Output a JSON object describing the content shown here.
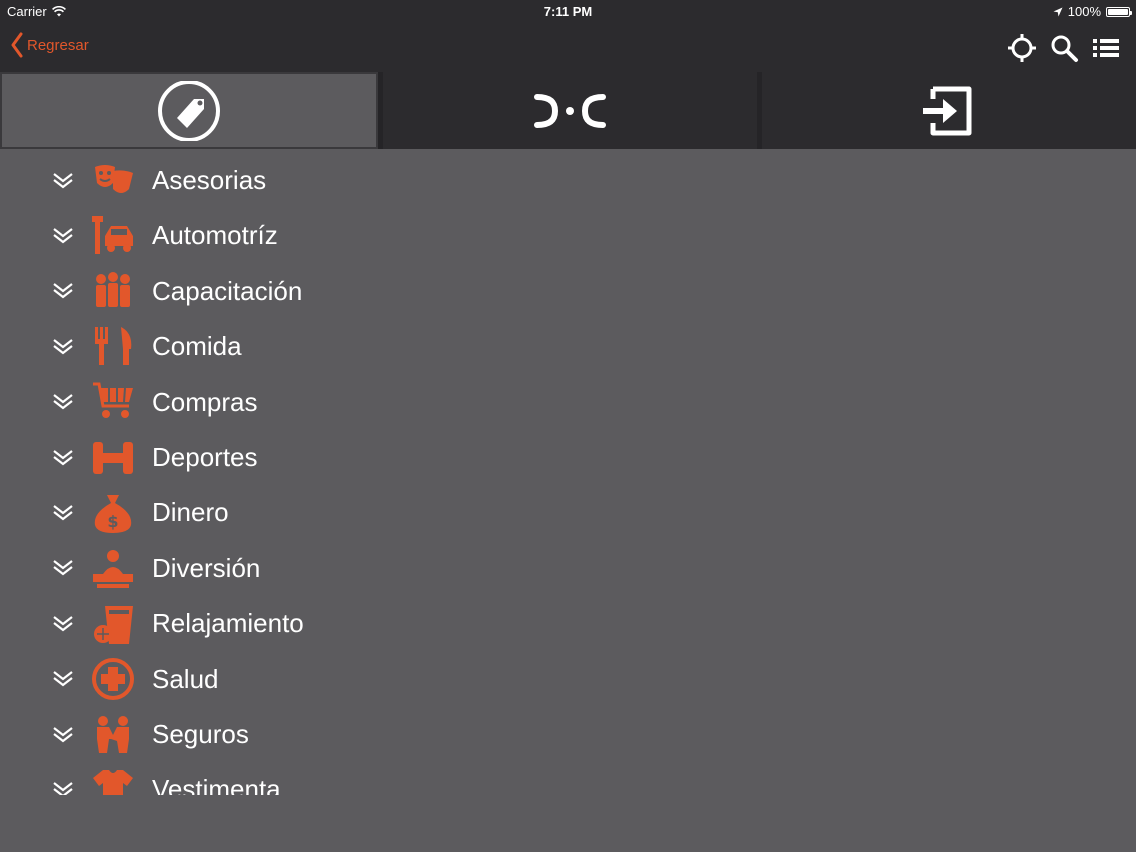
{
  "status_bar": {
    "carrier": "Carrier",
    "time": "7:11 PM",
    "battery": "100%"
  },
  "nav": {
    "back_label": "Regresar",
    "icons": [
      "crosshair-icon",
      "search-icon",
      "list-icon"
    ]
  },
  "tabs": [
    {
      "icon": "tag-icon",
      "active": true
    },
    {
      "icon": "logo-icon",
      "active": false
    },
    {
      "icon": "login-icon",
      "active": false
    }
  ],
  "categories": [
    {
      "label": "Asesorias",
      "icon": "theater-masks-icon"
    },
    {
      "label": "Automotríz",
      "icon": "car-wrench-icon"
    },
    {
      "label": "Capacitación",
      "icon": "people-group-icon"
    },
    {
      "label": "Comida",
      "icon": "fork-knife-icon"
    },
    {
      "label": "Compras",
      "icon": "shopping-cart-icon"
    },
    {
      "label": "Deportes",
      "icon": "dumbbell-icon"
    },
    {
      "label": "Dinero",
      "icon": "money-bag-icon"
    },
    {
      "label": "Diversión",
      "icon": "dj-icon"
    },
    {
      "label": "Relajamiento",
      "icon": "drink-icon"
    },
    {
      "label": "Salud",
      "icon": "medical-cross-icon"
    },
    {
      "label": "Seguros",
      "icon": "handshake-icon"
    },
    {
      "label": "Vestimenta",
      "icon": "tshirt-icon"
    }
  ],
  "colors": {
    "accent": "#e2572b",
    "navbar": "#2c2b2e",
    "background": "#5c5b5e",
    "text": "#ffffff"
  }
}
